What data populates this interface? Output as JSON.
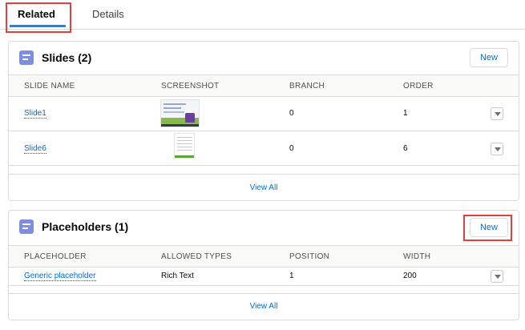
{
  "tabs": {
    "related": "Related",
    "details": "Details"
  },
  "slides": {
    "title": "Slides (2)",
    "new_label": "New",
    "columns": [
      "SLIDE NAME",
      "SCREENSHOT",
      "BRANCH",
      "ORDER"
    ],
    "rows": [
      {
        "name": "Slide1",
        "branch": "0",
        "order": "1"
      },
      {
        "name": "Slide6",
        "branch": "0",
        "order": "6"
      }
    ],
    "view_all": "View All"
  },
  "placeholders": {
    "title": "Placeholders (1)",
    "new_label": "New",
    "columns": [
      "PLACEHOLDER",
      "ALLOWED TYPES",
      "POSITION",
      "WIDTH"
    ],
    "rows": [
      {
        "name": "Generic placeholder",
        "allowed_types": "Rich Text",
        "position": "1",
        "width": "200"
      }
    ],
    "view_all": "View All"
  },
  "colors": {
    "link": "#006dcc",
    "highlight": "#e0403f",
    "tab_underline": "#1589ee",
    "icon": "#7f8de1"
  }
}
